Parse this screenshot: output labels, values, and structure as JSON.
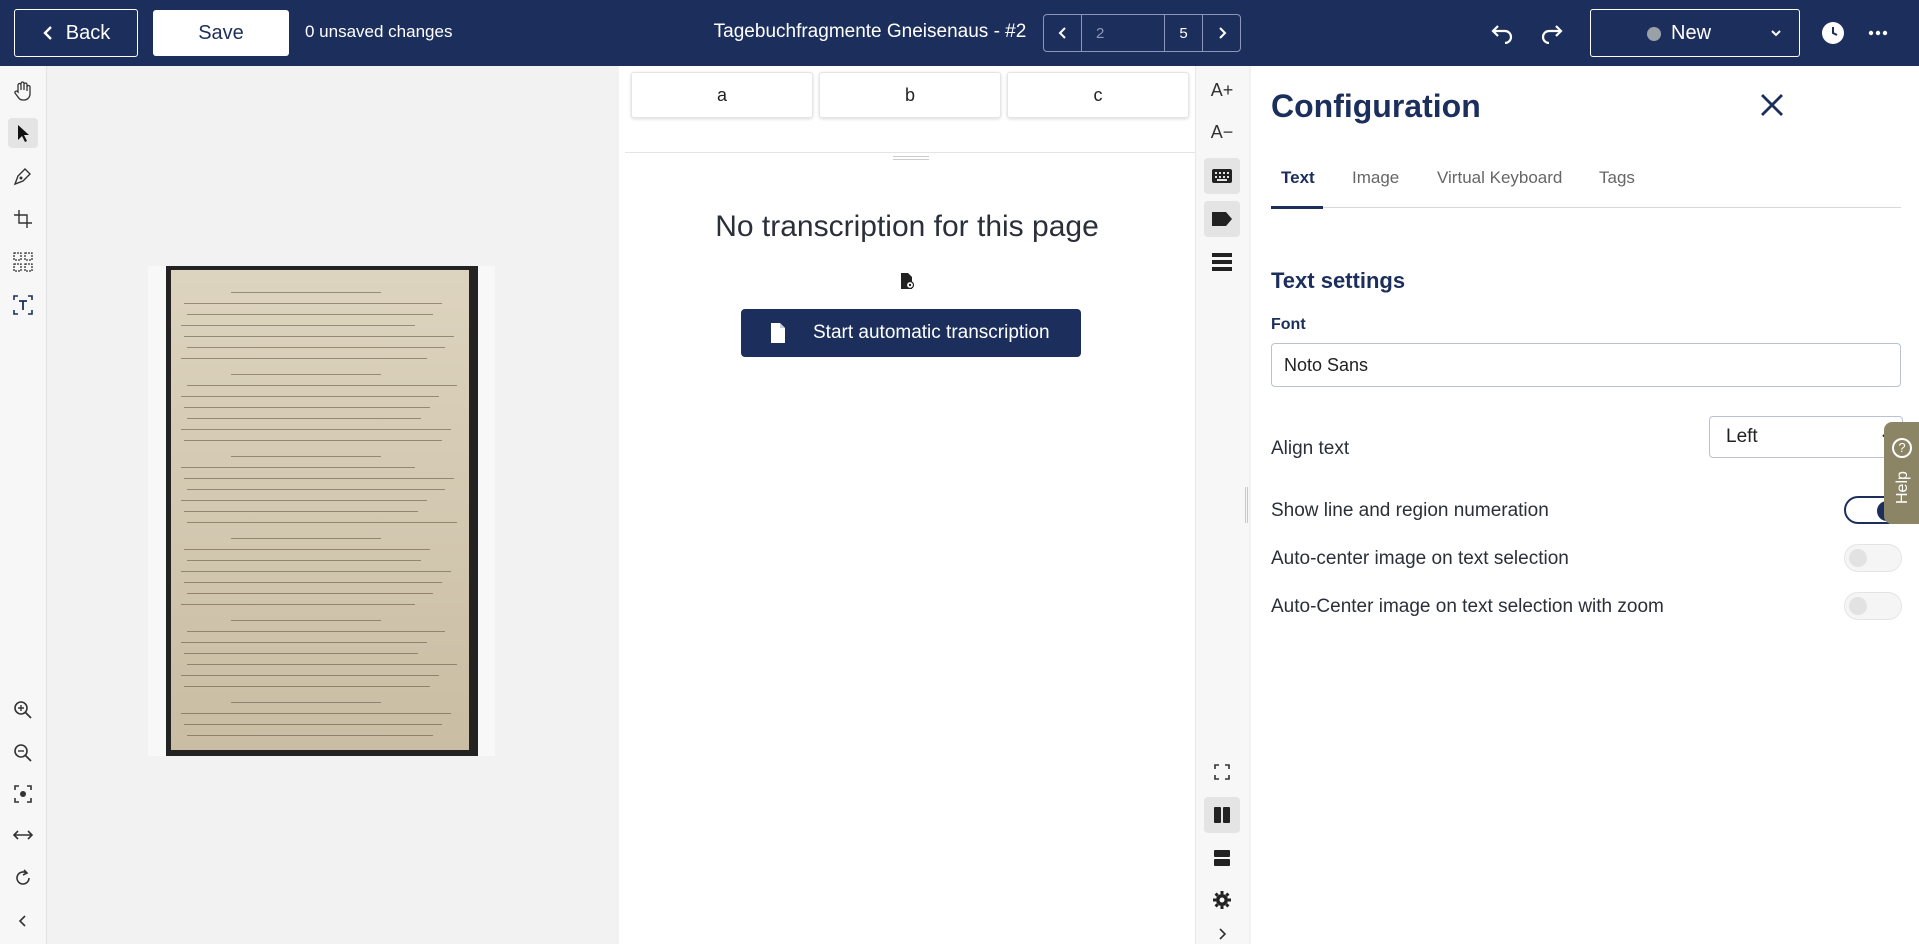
{
  "topbar": {
    "back_label": "Back",
    "save_label": "Save",
    "unsaved_text": "0 unsaved changes",
    "document_title": "Tagebuchfragmente Gneisenaus - #2",
    "pager": {
      "current_placeholder": "2",
      "total": "5"
    },
    "status": {
      "label": "New"
    }
  },
  "transcription": {
    "tabs": [
      "a",
      "b",
      "c"
    ],
    "empty_message": "No transcription for this page",
    "start_button_label": "Start automatic transcription"
  },
  "vstrip": {
    "font_increase": "A+",
    "font_decrease": "A−"
  },
  "config": {
    "title": "Configuration",
    "tabs": [
      {
        "label": "Text",
        "active": true
      },
      {
        "label": "Image",
        "active": false
      },
      {
        "label": "Virtual Keyboard",
        "active": false
      },
      {
        "label": "Tags",
        "active": false
      }
    ],
    "section_title": "Text settings",
    "font_label": "Font",
    "font_value": "Noto Sans",
    "align_label": "Align text",
    "align_value": "Left",
    "toggles": [
      {
        "label": "Show line and region numeration",
        "on": true
      },
      {
        "label": "Auto-center image on text selection",
        "on": false
      },
      {
        "label": "Auto-Center image on text selection with zoom",
        "on": false
      }
    ]
  },
  "help": {
    "label": "Help"
  },
  "colors": {
    "primary": "#1c2f5c",
    "help_tab": "#8c8565"
  }
}
